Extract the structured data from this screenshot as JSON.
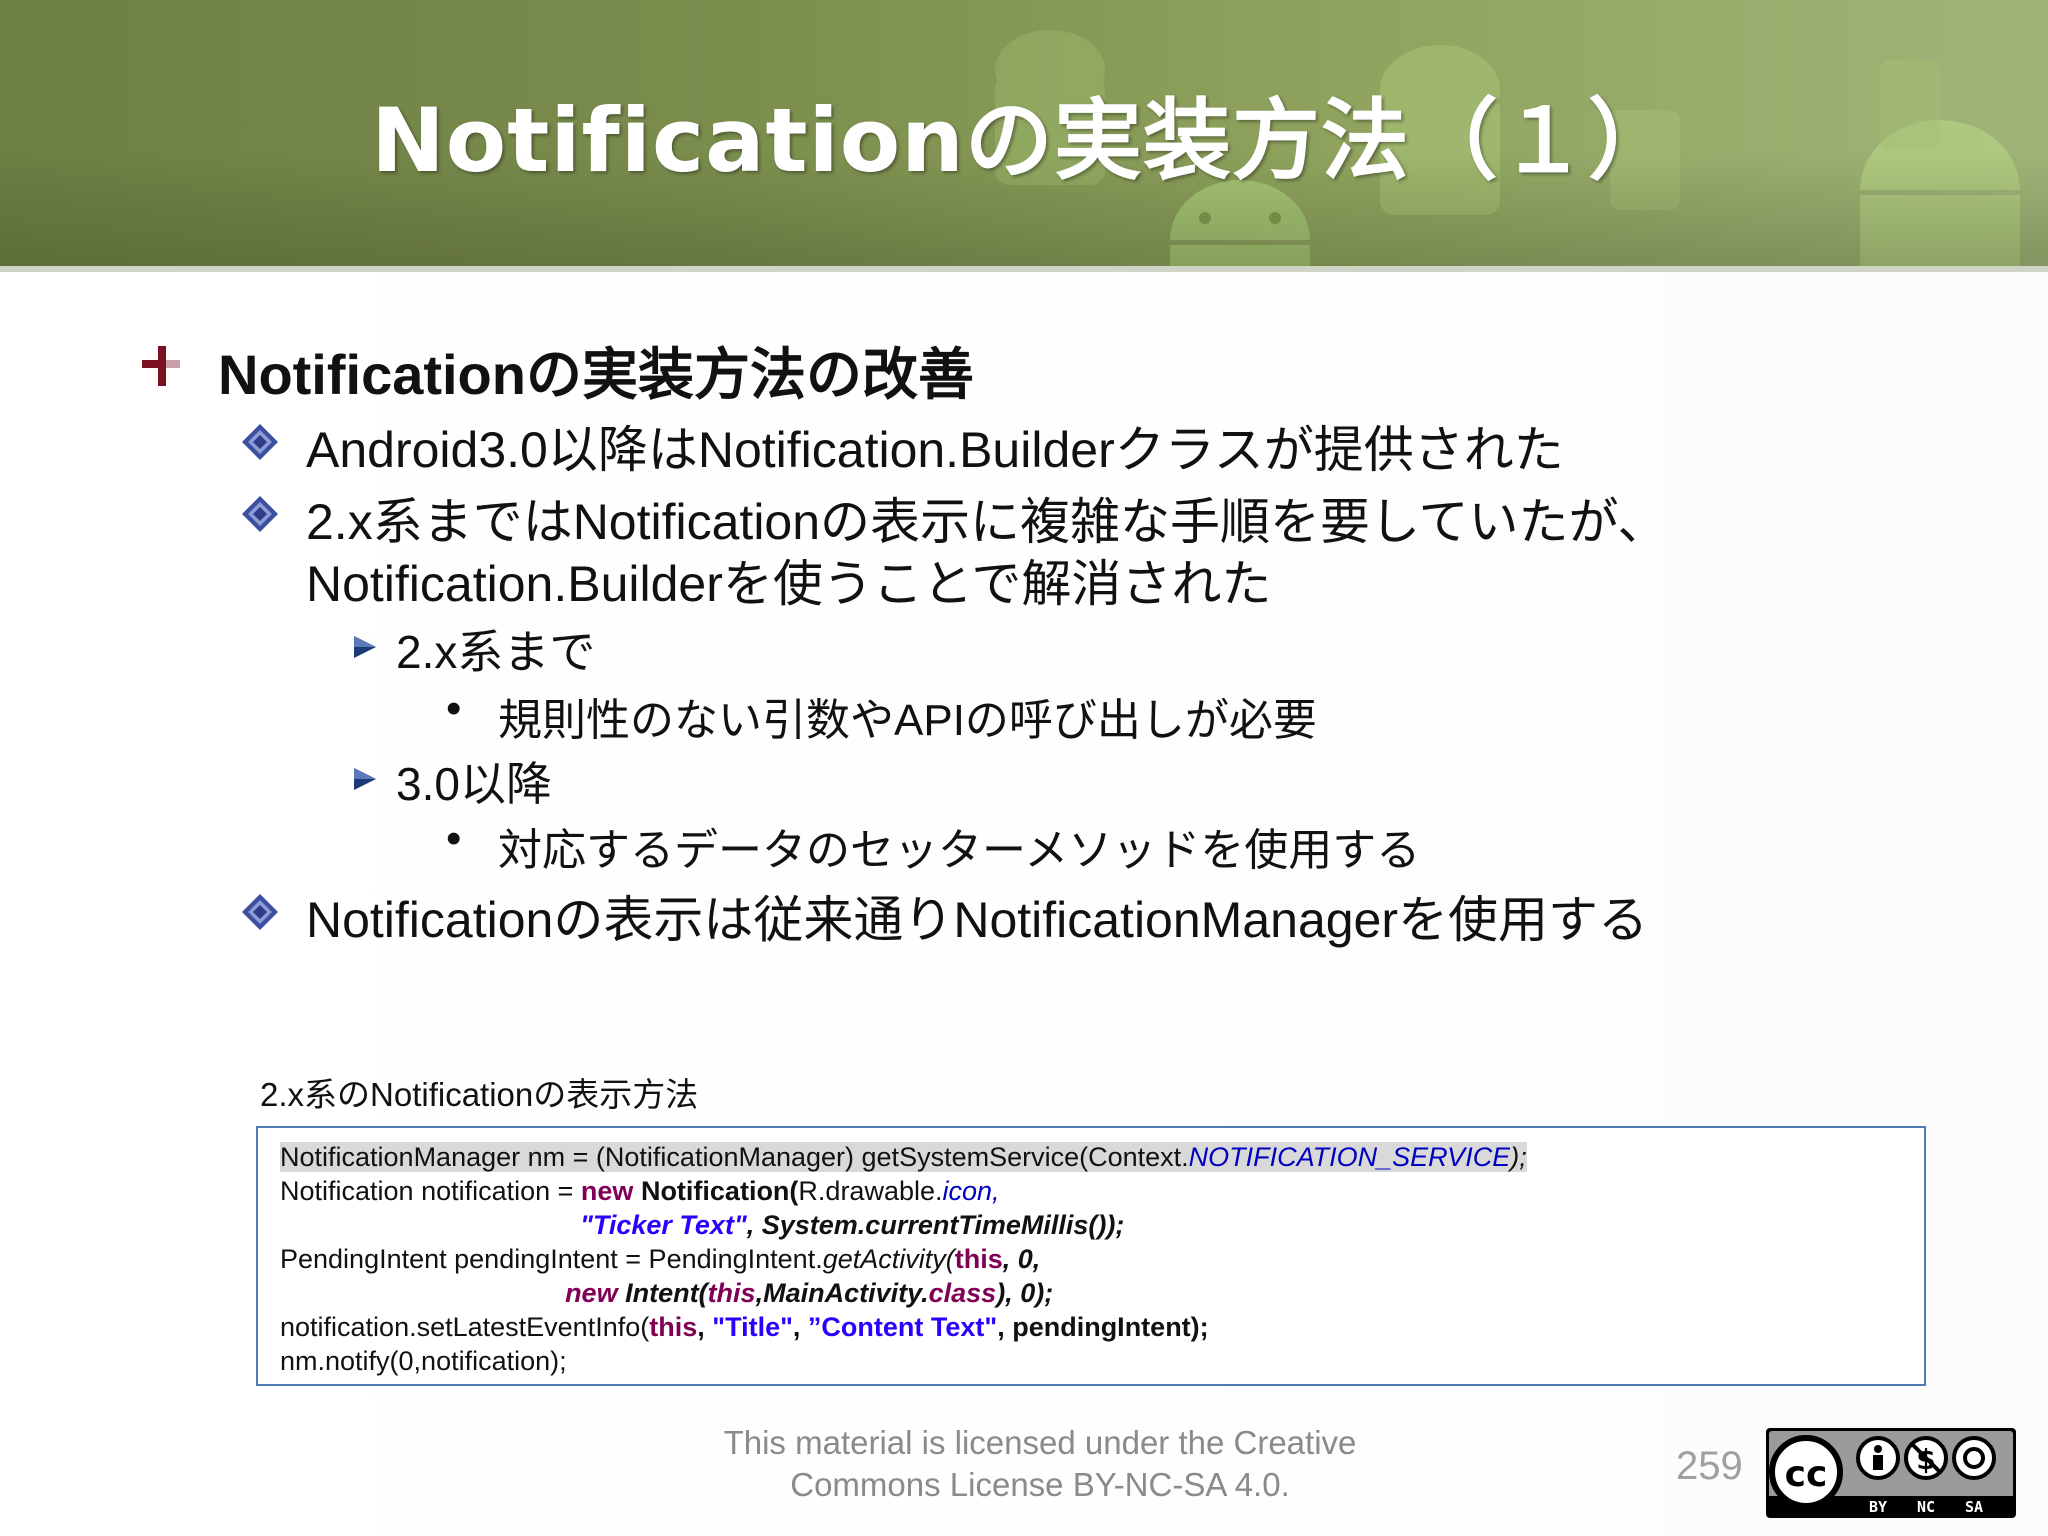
{
  "slide": {
    "title": "Notificationの実装方法（１）",
    "bullets": {
      "b1": "Notificationの実装方法の改善",
      "b1_1": "Android3.0以降はNotification.Builderクラスが提供された",
      "b1_2a": "2.x系まではNotificationの表示に複雑な手順を要していたが、",
      "b1_2b": "Notification.Builderを使うことで解消された",
      "b1_2_1": "2.x系まで",
      "b1_2_1_1": "規則性のない引数やAPIの呼び出しが必要",
      "b1_2_2": "3.0以降",
      "b1_2_2_1": "対応するデータのセッターメソッドを使用する",
      "b1_3": "Notificationの表示は従来通りNotificationManagerを使用する"
    },
    "code_caption": "2.x系のNotificationの表示方法",
    "code": {
      "r1a": "NotificationManager",
      "r1b": " nm = (NotificationManager) getSystemService(Context.",
      "r1c": "NOTIFICATION_SERVICE",
      "r1d": ");",
      "r2a": "Notification notification = ",
      "r2b": "new",
      "r2c": " Notification(",
      "r2d": "R.drawable.",
      "r2e": "icon,",
      "r3a": "                                        ",
      "r3b": "\"Ticker Text\"",
      "r3c": ", System.currentTimeMillis());",
      "r4a": "PendingIntent pendingIntent = PendingIntent.",
      "r4b": "getActivity(",
      "r4c": "this",
      "r4d": ", 0,",
      "r5a": "                                      ",
      "r5b": "new",
      "r5c": " Intent(",
      "r5d": "this",
      "r5e": ",MainActivity.",
      "r5f": "class",
      "r5g": "), 0);",
      "r6a": "notification.setLatestEventInfo(",
      "r6b": "this",
      "r6c": ", ",
      "r6d": "\"Title\"",
      "r6e": ", ",
      "r6f": "”Content Text\"",
      "r6g": ", pendingIntent);",
      "r7": "nm.notify(0,notification);"
    },
    "license_line1": "This material is licensed under the Creative",
    "license_line2": "Commons License BY-NC-SA 4.0.",
    "page_number": "259",
    "cc_badge": {
      "by": "BY",
      "nc": "NC",
      "sa": "SA"
    }
  },
  "colors": {
    "header_green": "#7a8d4d",
    "keyword": "#7f0055",
    "string": "#2a00ff",
    "field": "#0000c0",
    "code_border": "#4f7cb3",
    "bullet_diamond": "#3d4fa0",
    "bullet_triangle": "#1d3a78",
    "bullet_arrow": "#7a1020"
  },
  "icons": {
    "level1": "arrow-bullet-icon",
    "level2": "diamond-bullet-icon",
    "level3": "triangle-bullet-icon",
    "level4": "dot-bullet"
  }
}
